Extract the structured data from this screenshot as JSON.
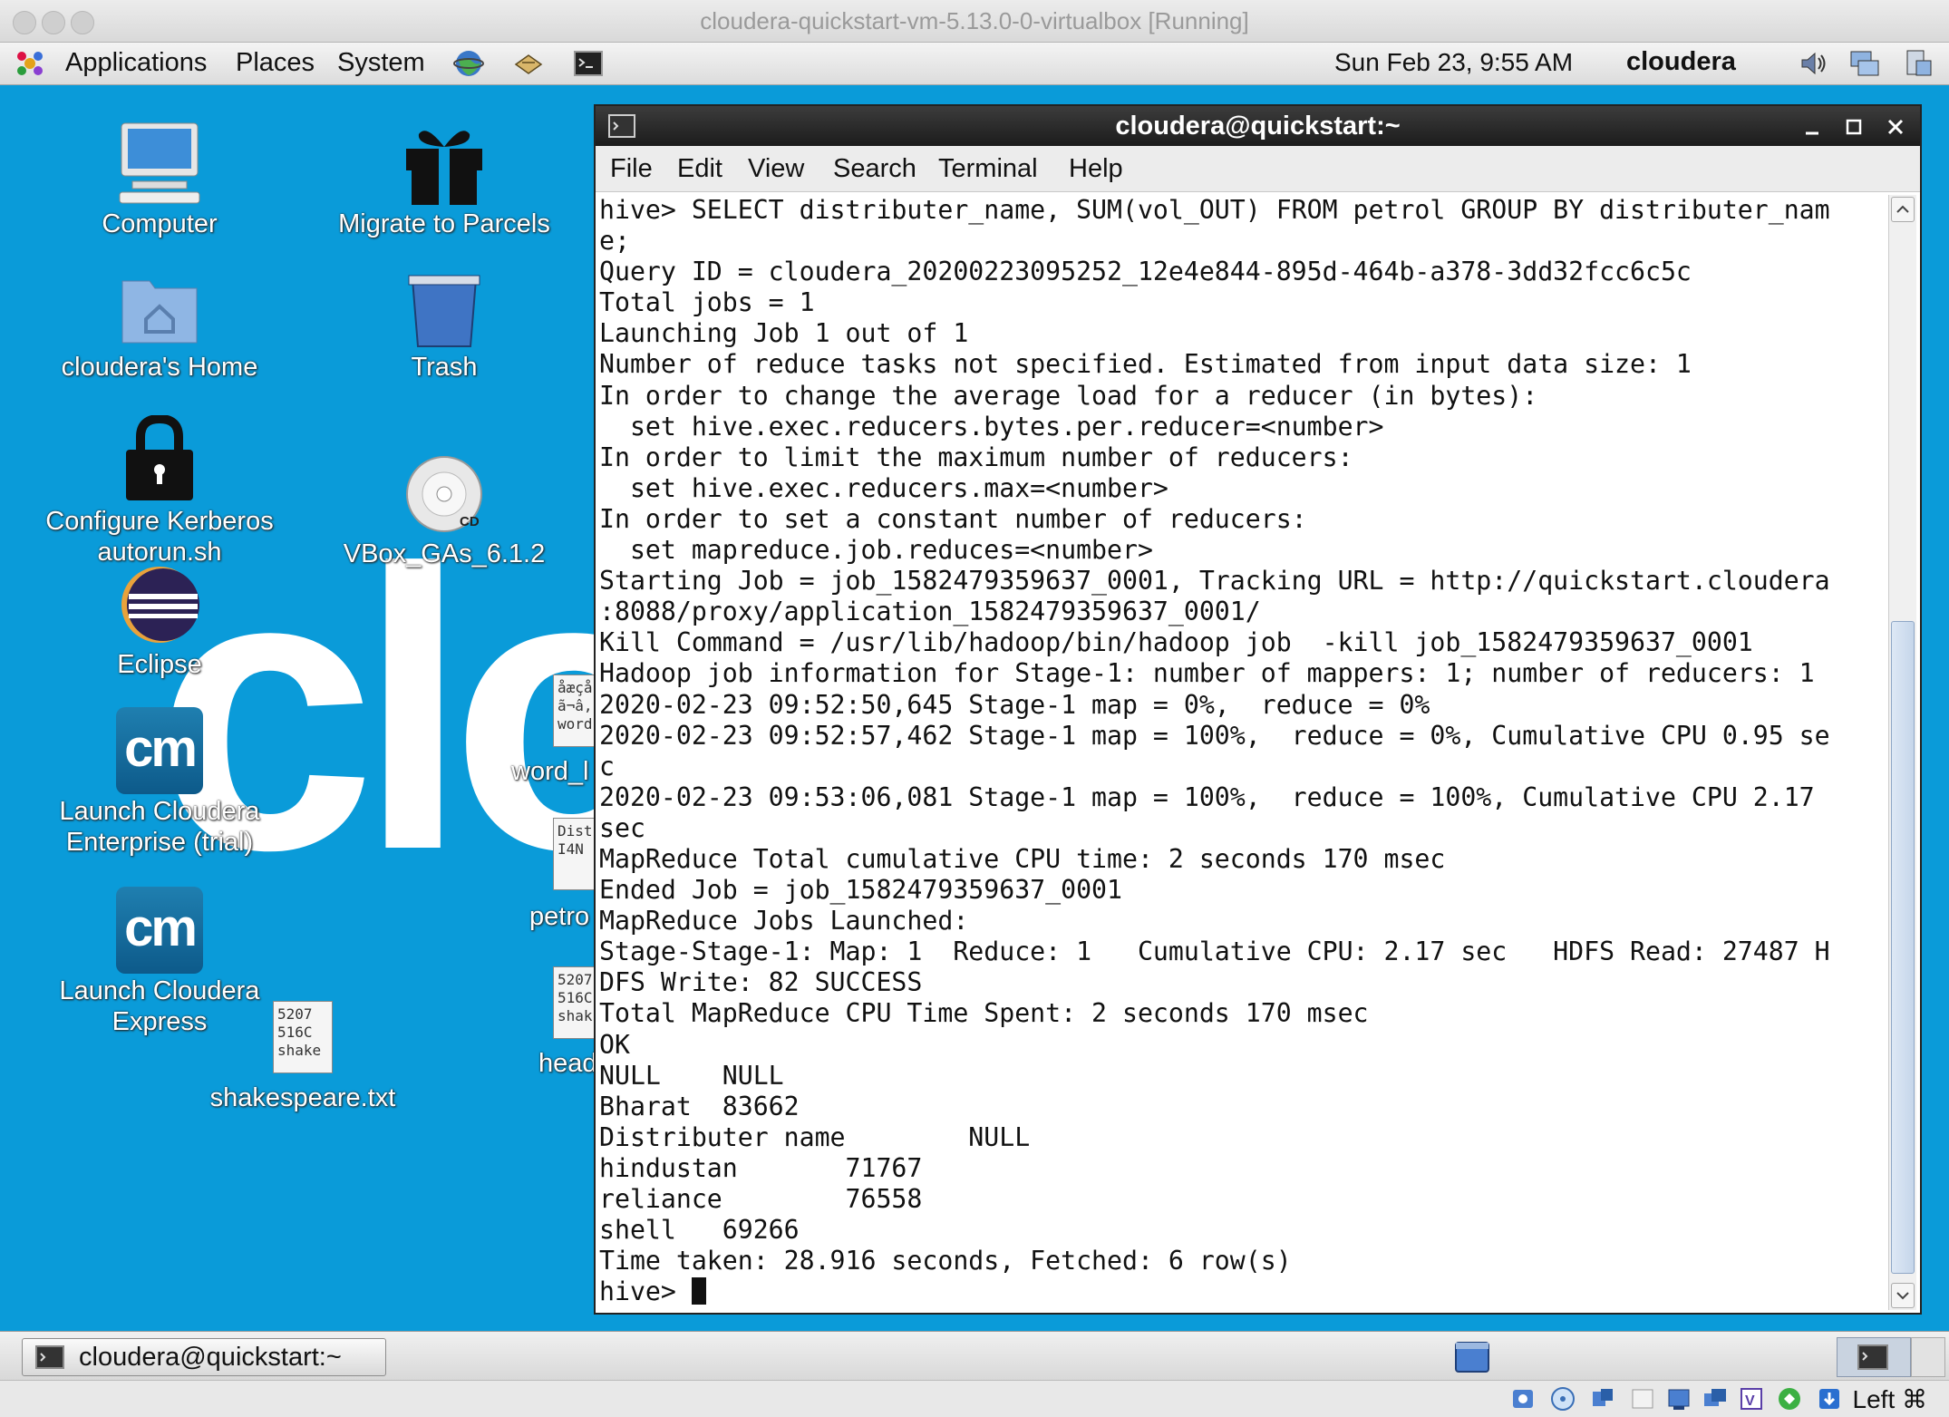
{
  "window": {
    "title": "cloudera-quickstart-vm-5.13.0-0-virtualbox [Running]"
  },
  "panel": {
    "menus": [
      "Applications",
      "Places",
      "System"
    ],
    "clock": "Sun Feb 23,  9:55 AM",
    "username": "cloudera"
  },
  "desktop": {
    "logo_fragment": "clo",
    "icons": {
      "computer": "Computer",
      "migrate": "Migrate to Parcels",
      "home": "cloudera's Home",
      "trash": "Trash",
      "kerberos": "Configure Kerberos",
      "autorun": "autorun.sh",
      "vbox": "VBox_GAs_6.1.2",
      "cd_badge": "CD",
      "eclipse": "Eclipse",
      "cm_trial_l1": "Launch Cloudera",
      "cm_trial_l2": "Enterprise (trial)",
      "cm_express_l1": "Launch Cloudera",
      "cm_express_l2": "Express",
      "cm_glyph": "cm",
      "shakespeare": "shakespeare.txt",
      "shakespeare_thumb": [
        "5207",
        "516C",
        "shake"
      ],
      "word": "word_l",
      "word_thumb": [
        "åæçå",
        "ã¬â,",
        "word"
      ],
      "petro": "petro",
      "petro_thumb": [
        "Dist",
        "",
        "I4N"
      ],
      "head": "head",
      "head_thumb": [
        "5207",
        "516C",
        "shak"
      ]
    }
  },
  "terminal": {
    "title": "cloudera@quickstart:~",
    "menu": [
      "File",
      "Edit",
      "View",
      "Search",
      "Terminal",
      "Help"
    ],
    "lines": [
      "hive> SELECT distributer_name, SUM(vol_OUT) FROM petrol GROUP BY distributer_nam",
      "e;",
      "Query ID = cloudera_20200223095252_12e4e844-895d-464b-a378-3dd32fcc6c5c",
      "Total jobs = 1",
      "Launching Job 1 out of 1",
      "Number of reduce tasks not specified. Estimated from input data size: 1",
      "In order to change the average load for a reducer (in bytes):",
      "  set hive.exec.reducers.bytes.per.reducer=<number>",
      "In order to limit the maximum number of reducers:",
      "  set hive.exec.reducers.max=<number>",
      "In order to set a constant number of reducers:",
      "  set mapreduce.job.reduces=<number>",
      "Starting Job = job_1582479359637_0001, Tracking URL = http://quickstart.cloudera",
      ":8088/proxy/application_1582479359637_0001/",
      "Kill Command = /usr/lib/hadoop/bin/hadoop job  -kill job_1582479359637_0001",
      "Hadoop job information for Stage-1: number of mappers: 1; number of reducers: 1",
      "2020-02-23 09:52:50,645 Stage-1 map = 0%,  reduce = 0%",
      "2020-02-23 09:52:57,462 Stage-1 map = 100%,  reduce = 0%, Cumulative CPU 0.95 se",
      "c",
      "2020-02-23 09:53:06,081 Stage-1 map = 100%,  reduce = 100%, Cumulative CPU 2.17",
      "sec",
      "MapReduce Total cumulative CPU time: 2 seconds 170 msec",
      "Ended Job = job_1582479359637_0001",
      "MapReduce Jobs Launched:",
      "Stage-Stage-1: Map: 1  Reduce: 1   Cumulative CPU: 2.17 sec   HDFS Read: 27487 H",
      "DFS Write: 82 SUCCESS",
      "Total MapReduce CPU Time Spent: 2 seconds 170 msec",
      "OK",
      "NULL    NULL",
      "Bharat  83662",
      "Distributer name        NULL",
      "hindustan       71767",
      "reliance        76558",
      "shell   69266",
      "Time taken: 28.916 seconds, Fetched: 6 row(s)"
    ],
    "prompt": "hive> "
  },
  "taskbar": {
    "window_button": "cloudera@quickstart:~"
  },
  "statusbar": {
    "host_key": "Left ⌘"
  },
  "colors": {
    "desktop": "#0a9bd9",
    "terminal_title": "#2a2a2a",
    "cm_tile": "#1a6fa0"
  }
}
